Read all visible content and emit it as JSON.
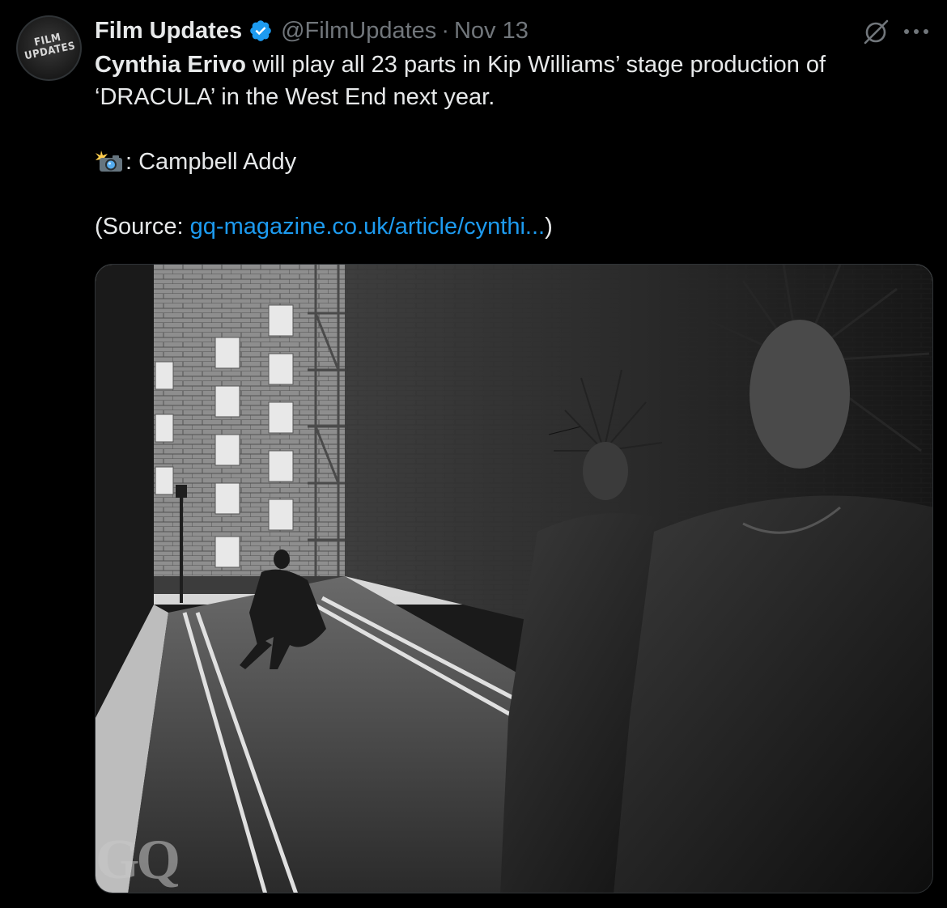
{
  "tweet": {
    "display_name": "Film Updates",
    "handle": "@FilmUpdates",
    "separator": "·",
    "date": "Nov 13",
    "avatar_text_line1": "FILM",
    "avatar_text_line2": "UPDATES",
    "text": {
      "bold_name": "Cynthia Erivo",
      "line1_rest": " will play all 23 parts in Kip Williams’ stage production of",
      "line2": "‘DRACULA’ in the West End next year.",
      "photo_credit_prefix": ": Campbell Addy",
      "source_prefix": "(Source: ",
      "source_link": "gq-magazine.co.uk/article/cynthi...",
      "source_suffix": ")"
    },
    "media": {
      "watermark": "GQ"
    }
  },
  "icons": {
    "verified": "verified-badge-icon",
    "grok": "grok-icon",
    "more": "more-options-icon",
    "camera": "camera-flash-emoji"
  },
  "colors": {
    "background": "#000000",
    "text": "#e7e9ea",
    "secondary": "#71767b",
    "link": "#1d9bf0",
    "verified": "#1d9bf0"
  }
}
